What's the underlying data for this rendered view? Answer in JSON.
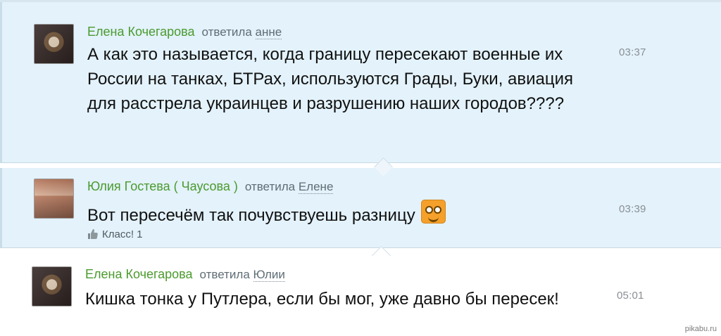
{
  "comments": [
    {
      "author": "Елена Кочегарова",
      "reply_prefix": "ответила",
      "reply_to": "анне",
      "text": "А как это называется, когда границу пересекают военные их России на танках, БТРах, используются  Грады, Буки, авиация для расстрела украинцев и разрушению наших городов????",
      "time": "03:37"
    },
    {
      "author": "Юлия Гостева ( Чаусова )",
      "reply_prefix": "ответила",
      "reply_to": "Елене",
      "text": "Вот пересечём так почувствуешь разницу",
      "emoji": "smile-emoji",
      "time": "03:39",
      "likes_label": "Класс! 1"
    },
    {
      "author": "Елена Кочегарова",
      "reply_prefix": "ответила",
      "reply_to": "Юлии",
      "text": "Кишка тонка у Путлера, если бы мог, уже давно бы пересек!",
      "time": "05:01"
    }
  ],
  "watermark": "pikabu.ru",
  "colors": {
    "author": "#4b9a2e",
    "highlight_background": "#e3f2fb",
    "timestamp": "#8a8f93",
    "emoji": "#f4a02a"
  }
}
